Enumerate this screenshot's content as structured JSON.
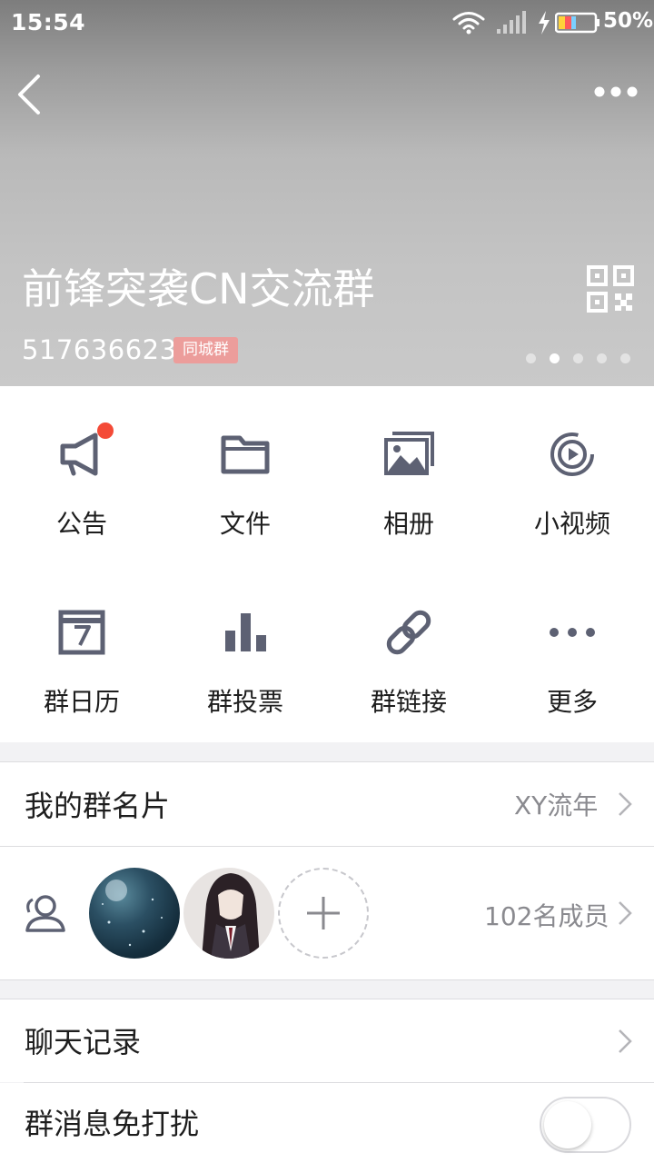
{
  "status_bar": {
    "time": "15:54",
    "battery": "50%"
  },
  "header": {
    "group_name": "前锋突袭CN交流群",
    "group_id": "517636623",
    "badge": "同城群",
    "page_dots": 5,
    "active_dot": 2
  },
  "features": [
    {
      "label": "公告",
      "icon": "megaphone-icon"
    },
    {
      "label": "文件",
      "icon": "folder-icon"
    },
    {
      "label": "相册",
      "icon": "photo-album-icon"
    },
    {
      "label": "小视频",
      "icon": "video-play-icon"
    },
    {
      "label": "群日历",
      "icon": "calendar-icon"
    },
    {
      "label": "群投票",
      "icon": "bar-chart-icon"
    },
    {
      "label": "群链接",
      "icon": "link-icon"
    },
    {
      "label": "更多",
      "icon": "more-dots-icon"
    }
  ],
  "card": {
    "title": "我的群名片",
    "value": "XY流年"
  },
  "members": {
    "count": "102名成员"
  },
  "chat_history": {
    "title": "聊天记录"
  },
  "mute": {
    "title": "群消息免打扰",
    "enabled": false
  },
  "colors": {
    "icon": "#5d6173",
    "notify": "#f44a37",
    "badge": "#ec9d9b"
  }
}
